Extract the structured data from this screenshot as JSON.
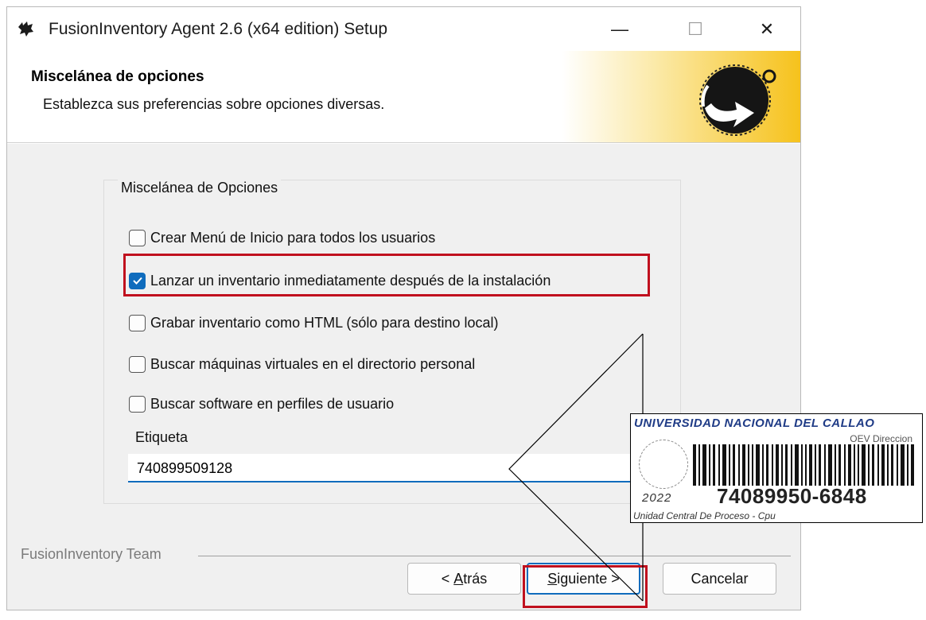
{
  "window": {
    "title": "FusionInventory Agent 2.6 (x64 edition) Setup",
    "controls": {
      "minimize": "—",
      "maximize": "☐",
      "close": "✕"
    }
  },
  "header": {
    "title": "Miscelánea de opciones",
    "subtitle": "Establezca sus preferencias sobre opciones diversas."
  },
  "group": {
    "legend": "Miscelánea de Opciones",
    "options": [
      {
        "label": "Crear Menú de Inicio para todos los usuarios",
        "checked": false
      },
      {
        "label": "Lanzar un inventario inmediatamente después de la instalación",
        "checked": true
      },
      {
        "label": "Grabar inventario como HTML (sólo para destino local)",
        "checked": false
      },
      {
        "label": "Buscar máquinas virtuales en el directorio personal",
        "checked": false
      },
      {
        "label": "Buscar software en perfiles de usuario",
        "checked": false
      }
    ],
    "tag_label": "Etiqueta",
    "tag_value": "740899509128"
  },
  "footer": {
    "brand": "FusionInventory Team",
    "back_label_prefix": "< ",
    "back_label_u": "A",
    "back_label_rest": "trás",
    "next_label_u": "S",
    "next_label_rest": "iguiente >",
    "cancel_label": "Cancelar"
  },
  "sticker": {
    "university": "UNIVERSIDAD NACIONAL DEL CALLAO",
    "office": "OEV Direccion",
    "year": "2022",
    "code": "74089950-6848",
    "description": "Unidad Central De Proceso - Cpu"
  },
  "colors": {
    "accent": "#0f6cbd",
    "highlight": "#c0101e",
    "header_gold": "#f6c21c"
  }
}
